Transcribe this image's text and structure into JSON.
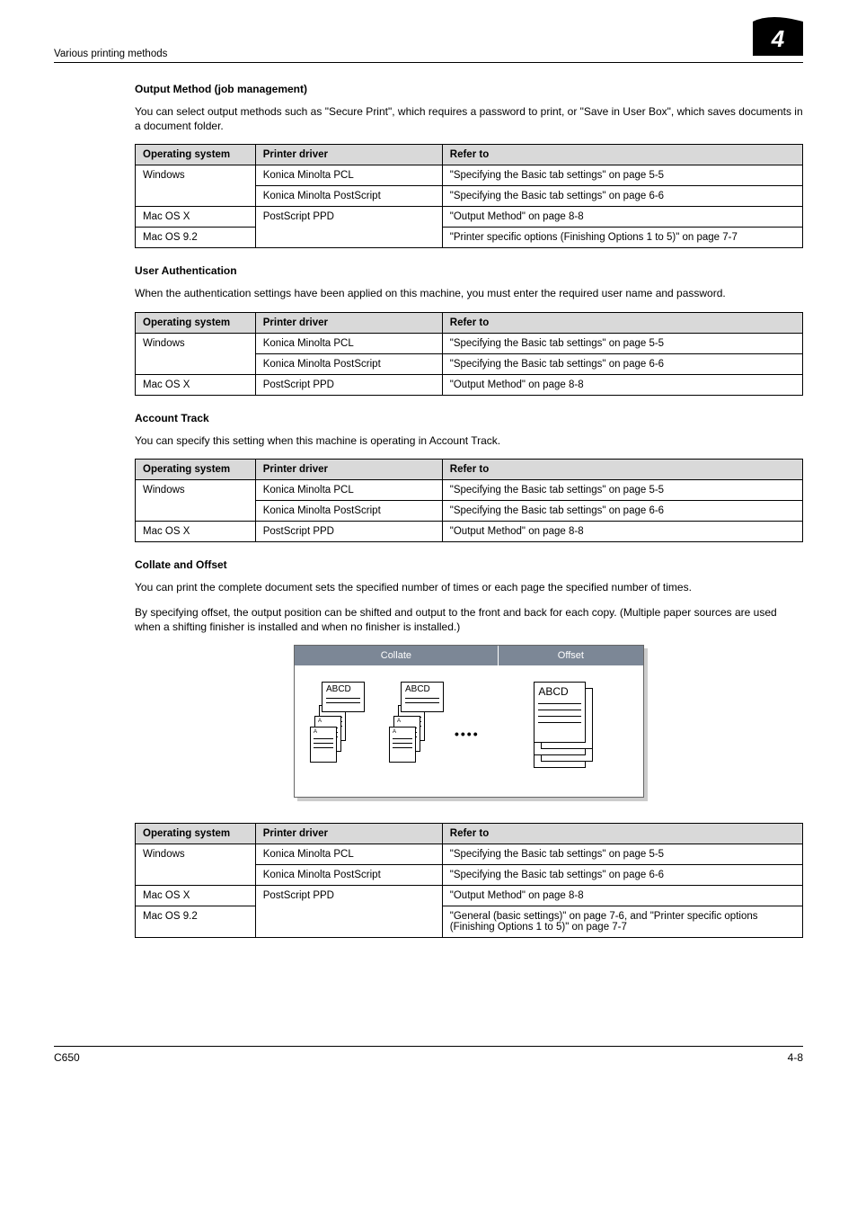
{
  "running_header": {
    "left": "Various printing methods",
    "chapter_number": "4"
  },
  "sections": [
    {
      "heading": "Output Method (job management)",
      "paragraphs": [
        "You can select output methods such as \"Secure Print\", which requires a password to print, or \"Save in User Box\", which saves documents in a document folder."
      ],
      "table": {
        "head": {
          "os": "Operating system",
          "drv": "Printer driver",
          "ref": "Refer to"
        },
        "rows": [
          {
            "os": "Windows",
            "os_rowspan": 2,
            "drv": "Konica Minolta PCL",
            "ref": "\"Specifying the Basic tab settings\" on page 5-5"
          },
          {
            "drv": "Konica Minolta PostScript",
            "ref": "\"Specifying the Basic tab settings\" on page 6-6"
          },
          {
            "os": "Mac OS X",
            "drv": "PostScript PPD",
            "drv_rowspan": 2,
            "ref": "\"Output Method\" on page 8-8"
          },
          {
            "os": "Mac OS 9.2",
            "ref": "\"Printer specific options (Finishing Options 1 to 5)\" on page 7-7"
          }
        ]
      }
    },
    {
      "heading": "User Authentication",
      "paragraphs": [
        "When the authentication settings have been applied on this machine, you must enter the required user name and password."
      ],
      "table": {
        "head": {
          "os": "Operating system",
          "drv": "Printer driver",
          "ref": "Refer to"
        },
        "rows": [
          {
            "os": "Windows",
            "os_rowspan": 2,
            "drv": "Konica Minolta PCL",
            "ref": "\"Specifying the Basic tab settings\" on page 5-5"
          },
          {
            "drv": "Konica Minolta PostScript",
            "ref": "\"Specifying the Basic tab settings\" on page 6-6"
          },
          {
            "os": "Mac OS X",
            "drv": "PostScript PPD",
            "ref": "\"Output Method\" on page 8-8"
          }
        ]
      }
    },
    {
      "heading": "Account Track",
      "paragraphs": [
        "You can specify this setting when this machine is operating in Account Track."
      ],
      "table": {
        "head": {
          "os": "Operating system",
          "drv": "Printer driver",
          "ref": "Refer to"
        },
        "rows": [
          {
            "os": "Windows",
            "os_rowspan": 2,
            "drv": "Konica Minolta PCL",
            "ref": "\"Specifying the Basic tab settings\" on page 5-5"
          },
          {
            "drv": "Konica Minolta PostScript",
            "ref": "\"Specifying the Basic tab settings\" on page 6-6"
          },
          {
            "os": "Mac OS X",
            "drv": "PostScript PPD",
            "ref": "\"Output Method\" on page 8-8"
          }
        ]
      }
    },
    {
      "heading": "Collate and Offset",
      "paragraphs": [
        "You can print the complete document sets the specified number of times or each page the specified number of times.",
        "By specifying offset, the output position can be shifted and output to the front and back for each copy. (Multiple paper sources are used when a shifting finisher is installed and when no finisher is installed.)"
      ],
      "figure": {
        "collate_label": "Collate",
        "offset_label": "Offset",
        "page_text": "ABCD"
      },
      "table": {
        "head": {
          "os": "Operating system",
          "drv": "Printer driver",
          "ref": "Refer to"
        },
        "rows": [
          {
            "os": "Windows",
            "os_rowspan": 2,
            "drv": "Konica Minolta PCL",
            "ref": "\"Specifying the Basic tab settings\" on page 5-5"
          },
          {
            "drv": "Konica Minolta PostScript",
            "ref": "\"Specifying the Basic tab settings\" on page 6-6"
          },
          {
            "os": "Mac OS X",
            "drv": "PostScript PPD",
            "drv_rowspan": 2,
            "ref": "\"Output Method\" on page 8-8"
          },
          {
            "os": "Mac OS 9.2",
            "ref": "\"General (basic settings)\" on page 7-6, and \"Printer specific options (Finishing Options 1 to 5)\" on page 7-7"
          }
        ]
      }
    }
  ],
  "footer": {
    "left": "C650",
    "right": "4-8"
  }
}
